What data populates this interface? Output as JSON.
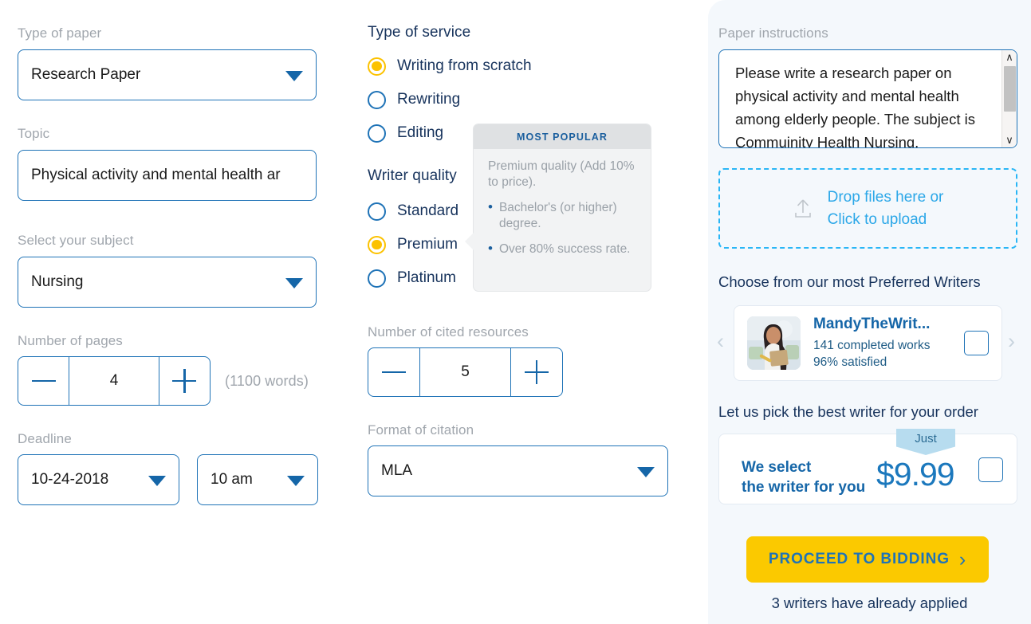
{
  "left_column": {
    "type_of_paper": {
      "label": "Type of paper",
      "value": "Research Paper",
      "caret_icon": "chevron-down-icon"
    },
    "topic": {
      "label": "Topic",
      "value": "Physical activity and mental health ar"
    },
    "subject": {
      "label": "Select your subject",
      "value": "Nursing",
      "caret_icon": "chevron-down-icon"
    },
    "pages": {
      "label": "Number of pages",
      "value": "4",
      "minus_icon": "minus-icon",
      "plus_icon": "plus-icon",
      "words_note": "(1100 words)"
    },
    "deadline": {
      "label": "Deadline",
      "date_value": "10-24-2018",
      "time_value": "10 am",
      "caret_icon": "chevron-down-icon"
    }
  },
  "middle_column": {
    "type_of_service": {
      "label": "Type of service",
      "options": [
        {
          "label": "Writing from scratch",
          "selected": true
        },
        {
          "label": "Rewriting",
          "selected": false
        },
        {
          "label": "Editing",
          "selected": false
        }
      ]
    },
    "writer_quality": {
      "label": "Writer quality",
      "options": [
        {
          "label": "Standard",
          "selected": false
        },
        {
          "label": "Premium",
          "selected": true
        },
        {
          "label": "Platinum",
          "selected": false
        }
      ]
    },
    "tooltip": {
      "header": "MOST POPULAR",
      "description": "Premium quality (Add 10% to price).",
      "bullets": [
        "Bachelor's (or higher) degree.",
        "Over 80% success rate."
      ]
    },
    "cited_resources": {
      "label": "Number of cited resources",
      "value": "5",
      "minus_icon": "minus-icon",
      "plus_icon": "plus-icon"
    },
    "citation_format": {
      "label": "Format of citation",
      "value": "MLA",
      "caret_icon": "chevron-down-icon"
    }
  },
  "right_panel": {
    "instructions": {
      "label": "Paper instructions",
      "value": "Please write a research paper on physical activity and mental health among elderly people. The subject is Commuinity Health Nursing.",
      "scroll_up_icon": "chevron-up-icon",
      "scroll_down_icon": "chevron-down-icon"
    },
    "upload": {
      "line1": "Drop files here or",
      "line2": "Click to upload",
      "icon": "upload-icon"
    },
    "preferred_writers": {
      "title": "Choose from our most Preferred Writers",
      "prev_icon": "chevron-left-icon",
      "next_icon": "chevron-right-icon",
      "writer": {
        "name": "MandyTheWrit...",
        "completed": "141 completed works",
        "satisfied": "96% satisfied",
        "avatar_icon": "avatar",
        "checkbox_icon": "checkbox"
      }
    },
    "auto_pick": {
      "title": "Let us pick the best writer for your order",
      "line1": "We select",
      "line2": "the writer for you",
      "badge": "Just",
      "price": "$9.99",
      "checkbox_icon": "checkbox"
    },
    "cta": {
      "label": "PROCEED TO BIDDING",
      "arrow_icon": "chevron-right-icon",
      "applied_note": "3 writers have already applied"
    }
  },
  "colors": {
    "accent_blue": "#1f73b7",
    "dark_navy": "#17335c",
    "label_gray": "#a0a6ad",
    "yellow": "#fbc900",
    "radio_yellow": "#fcc200",
    "panel_bg": "#f4f8fc",
    "cyan_dashed": "#29b6f6"
  }
}
